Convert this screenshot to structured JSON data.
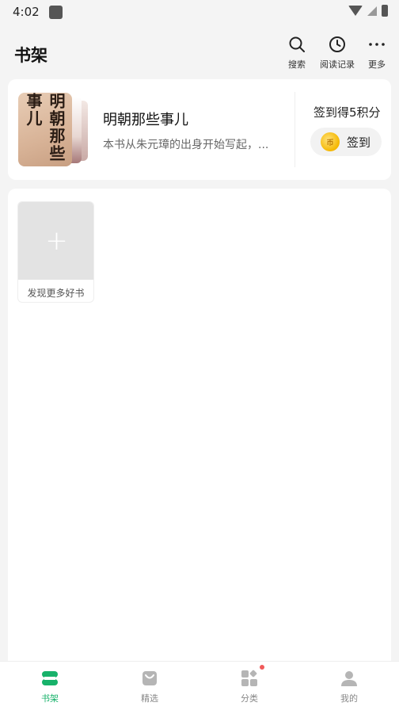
{
  "status_bar": {
    "time": "4:02"
  },
  "header": {
    "title": "书架",
    "actions": [
      {
        "label": "搜索",
        "icon": "search-icon"
      },
      {
        "label": "阅读记录",
        "icon": "clock-icon"
      },
      {
        "label": "更多",
        "icon": "more-icon"
      }
    ]
  },
  "recent_book": {
    "title": "明朝那些事儿",
    "description": "本书从朱元璋的出身开始写起，...",
    "cover_text": "明朝那些事儿"
  },
  "sign_in": {
    "hint": "签到得5积分",
    "button_label": "签到",
    "coin_text": "币"
  },
  "shelf": {
    "discover_label": "发现更多好书",
    "discover_icon": "+"
  },
  "bottom_nav": {
    "items": [
      {
        "label": "书架",
        "icon": "bookshelf-icon",
        "active": true
      },
      {
        "label": "精选",
        "icon": "bag-icon",
        "active": false
      },
      {
        "label": "分类",
        "icon": "category-icon",
        "active": false
      },
      {
        "label": "我的",
        "icon": "person-icon",
        "active": false
      }
    ]
  },
  "colors": {
    "accent": "#17b26a",
    "background": "#f4f4f4",
    "badge": "#f05a5a"
  }
}
